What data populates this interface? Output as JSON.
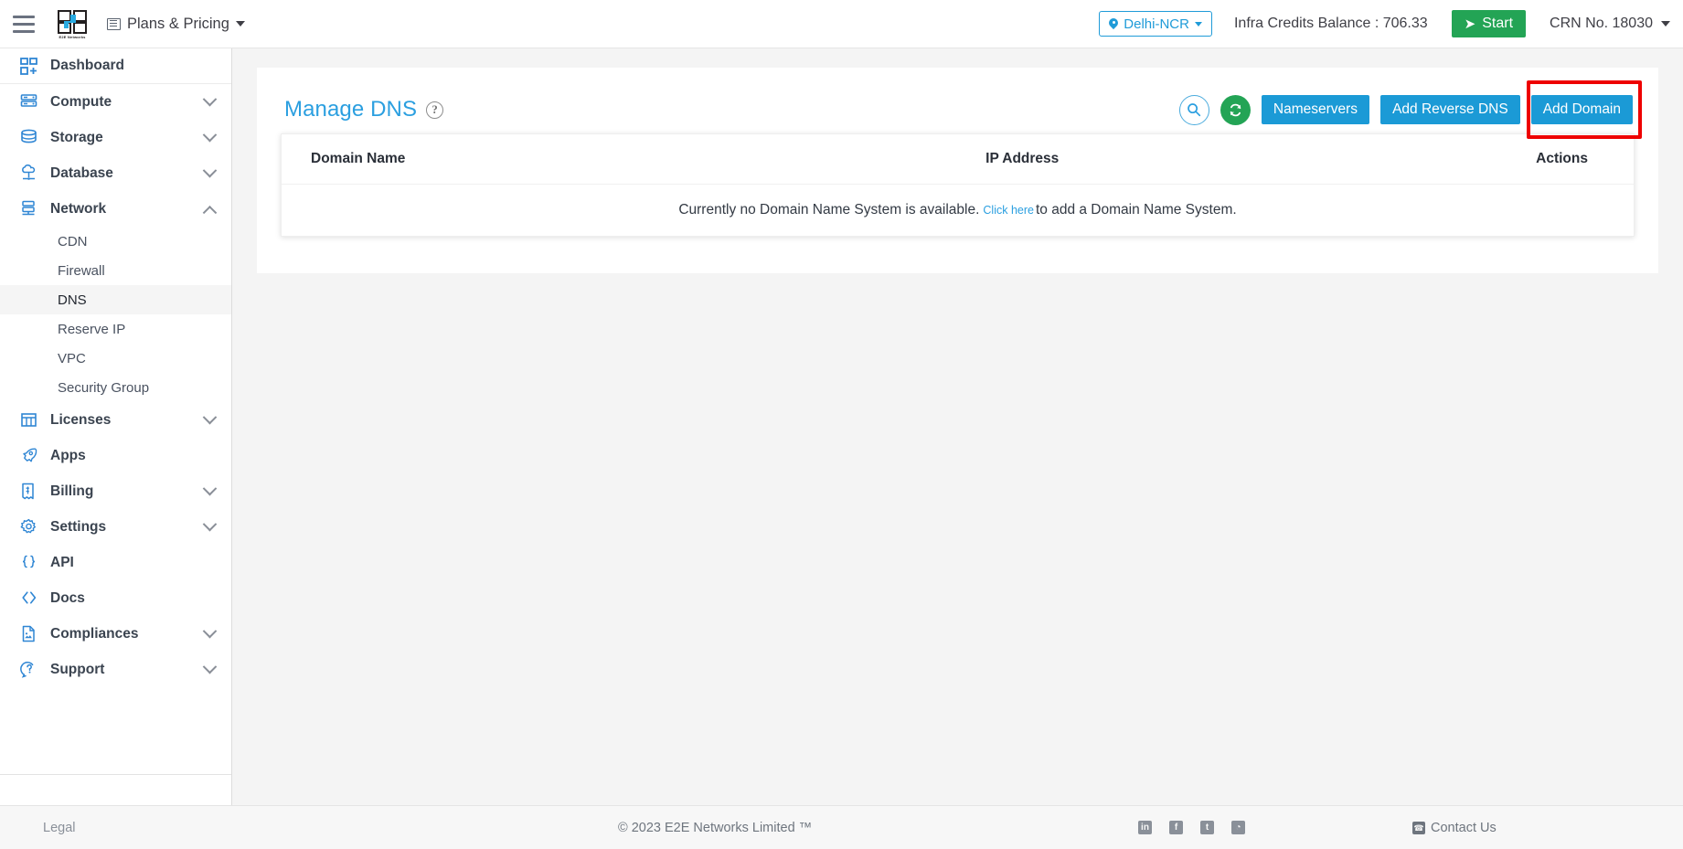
{
  "topbar": {
    "menu_icon": "hamburger-icon",
    "logo_alt": "E2E Networks",
    "logo_caption": "E2E Networks",
    "plans_label": "Plans & Pricing",
    "region_label": "Delhi-NCR",
    "credits_label": "Infra Credits Balance : 706.33",
    "start_label": "Start",
    "crn_label": "CRN No. 18030"
  },
  "sidebar": {
    "items": [
      {
        "label": "Dashboard",
        "icon": "dashboard-grid-icon",
        "expandable": false,
        "expanded": false
      },
      {
        "label": "Compute",
        "icon": "server-rack-icon",
        "expandable": true,
        "expanded": false
      },
      {
        "label": "Storage",
        "icon": "database-disk-icon",
        "expandable": true,
        "expanded": false
      },
      {
        "label": "Database",
        "icon": "cloud-database-icon",
        "expandable": true,
        "expanded": false
      },
      {
        "label": "Network",
        "icon": "network-node-icon",
        "expandable": true,
        "expanded": true
      },
      {
        "label": "Licenses",
        "icon": "licenses-grid-icon",
        "expandable": true,
        "expanded": false
      },
      {
        "label": "Apps",
        "icon": "rocket-icon",
        "expandable": false,
        "expanded": false
      },
      {
        "label": "Billing",
        "icon": "invoice-dollar-icon",
        "expandable": true,
        "expanded": false
      },
      {
        "label": "Settings",
        "icon": "gear-icon",
        "expandable": true,
        "expanded": false
      },
      {
        "label": "API",
        "icon": "curly-braces-icon",
        "expandable": false,
        "expanded": false
      },
      {
        "label": "Docs",
        "icon": "angle-brackets-icon",
        "expandable": false,
        "expanded": false
      },
      {
        "label": "Compliances",
        "icon": "document-icon",
        "expandable": true,
        "expanded": false
      },
      {
        "label": "Support",
        "icon": "support-chat-icon",
        "expandable": true,
        "expanded": false
      }
    ],
    "network_children": [
      {
        "label": "CDN",
        "active": false
      },
      {
        "label": "Firewall",
        "active": false
      },
      {
        "label": "DNS",
        "active": true
      },
      {
        "label": "Reserve IP",
        "active": false
      },
      {
        "label": "VPC",
        "active": false
      },
      {
        "label": "Security Group",
        "active": false
      }
    ]
  },
  "page": {
    "title": "Manage DNS",
    "help_icon": "question-mark-icon",
    "actions": {
      "search_icon": "search-icon",
      "refresh_icon": "refresh-icon",
      "nameservers_label": "Nameservers",
      "add_reverse_dns_label": "Add Reverse DNS",
      "add_domain_label": "Add Domain",
      "highlighted_action": "Add Domain"
    },
    "table": {
      "columns": [
        "Domain Name",
        "IP Address",
        "Actions"
      ],
      "rows": [],
      "empty_message_prefix": "Currently no Domain Name System is available.",
      "empty_link_text": "Click here",
      "empty_message_suffix": "to add a Domain Name System."
    }
  },
  "footer": {
    "legal_label": "Legal",
    "copyright": "© 2023 E2E Networks Limited ™",
    "social": [
      {
        "name": "linkedin-icon",
        "glyph": "in"
      },
      {
        "name": "facebook-icon",
        "glyph": "f"
      },
      {
        "name": "twitter-icon",
        "glyph": "t"
      },
      {
        "name": "rss-icon",
        "glyph": "◔"
      }
    ],
    "contact_label": "Contact Us",
    "contact_icon": "phone-icon"
  },
  "colors": {
    "accent_blue": "#1b9ad6",
    "title_blue": "#2b9fe0",
    "green": "#23a455",
    "highlight_red": "#ee0000",
    "page_bg": "#f4f4f4"
  }
}
